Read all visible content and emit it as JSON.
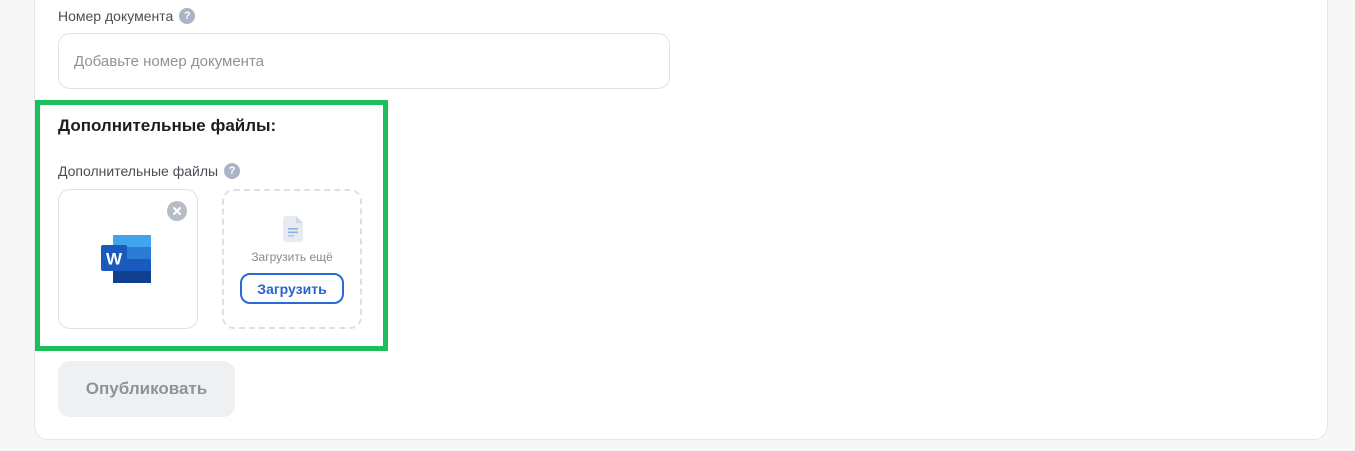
{
  "document_number": {
    "label": "Номер документа",
    "placeholder": "Добавьте номер документа",
    "value": ""
  },
  "additional_files": {
    "title": "Дополнительные файлы:",
    "label": "Дополнительные файлы",
    "files": [
      {
        "type": "word-document",
        "icon": "word-icon"
      }
    ],
    "upload": {
      "text": "Загрузить ещё",
      "button_label": "Загрузить"
    }
  },
  "actions": {
    "publish_label": "Опубликовать"
  },
  "icons": {
    "help": "?"
  },
  "colors": {
    "accent": "#2a6ad6",
    "highlight": "#1ebe5b",
    "publish_bg": "#eff0f2",
    "publish_text": "#8e939a"
  }
}
